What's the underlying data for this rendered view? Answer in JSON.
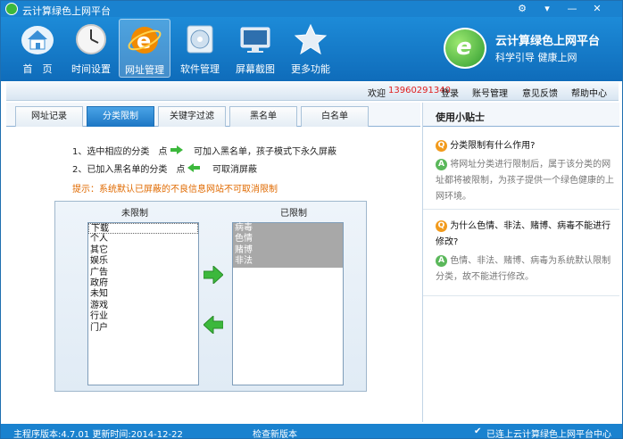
{
  "window": {
    "title": "云计算绿色上网平台"
  },
  "nav": [
    {
      "label": "首　页",
      "icon": "house-icon"
    },
    {
      "label": "时间设置",
      "icon": "clock-icon"
    },
    {
      "label": "网址管理",
      "icon": "ie-browser-icon"
    },
    {
      "label": "软件管理",
      "icon": "disc-icon"
    },
    {
      "label": "屏幕截图",
      "icon": "monitor-icon"
    },
    {
      "label": "更多功能",
      "icon": "star-icon"
    }
  ],
  "brand": {
    "name": "云计算绿色上网平台",
    "slogan": "科学引导 健康上网",
    "logo_letter": "e"
  },
  "userbar": {
    "welcome": "欢迎",
    "phone": "13960291340",
    "login": "登录",
    "account": "账号管理",
    "feedback": "意见反馈",
    "help": "帮助中心"
  },
  "tabs": [
    "网址记录",
    "分类限制",
    "关键字过滤",
    "黑名单",
    "白名单"
  ],
  "instructions": {
    "step1_a": "1、选中相应的分类　点",
    "step1_b": "可加入黑名单，孩子模式下永久屏蔽",
    "step2_a": "2、已加入黑名单的分类　点",
    "step2_b": "可取消屏蔽",
    "tip": "提示：系统默认已屏蔽的不良信息网站不可取消限制"
  },
  "lists": {
    "unrestricted_title": "未限制",
    "restricted_title": "已限制",
    "unrestricted": [
      "下载",
      "个人",
      "其它",
      "娱乐",
      "广告",
      "政府",
      "未知",
      "游戏",
      "行业",
      "门户"
    ],
    "restricted": [
      "病毒",
      "色情",
      "赌博",
      "非法"
    ]
  },
  "tips": {
    "title": "使用小贴士",
    "q_badge": "Q",
    "a_badge": "A",
    "q1": "分类限制有什么作用?",
    "a1": "将网址分类进行限制后，属于该分类的网址都将被限制，为孩子提供一个绿色健康的上网环境。",
    "q2": "为什么色情、非法、赌博、病毒不能进行修改?",
    "a2": "色情、非法、赌博、病毒为系统默认限制分类，故不能进行修改。"
  },
  "status": {
    "version": "主程序版本:4.7.01 更新时间:2014-12-22",
    "check": "检查新版本",
    "connected": "已连上云计算绿色上网平台中心"
  },
  "colors": {
    "accent": "#1a82cf",
    "green": "#3cb83c",
    "tip": "#e06a00",
    "q_badge": "#f29b1d",
    "a_badge": "#5bb85b"
  }
}
